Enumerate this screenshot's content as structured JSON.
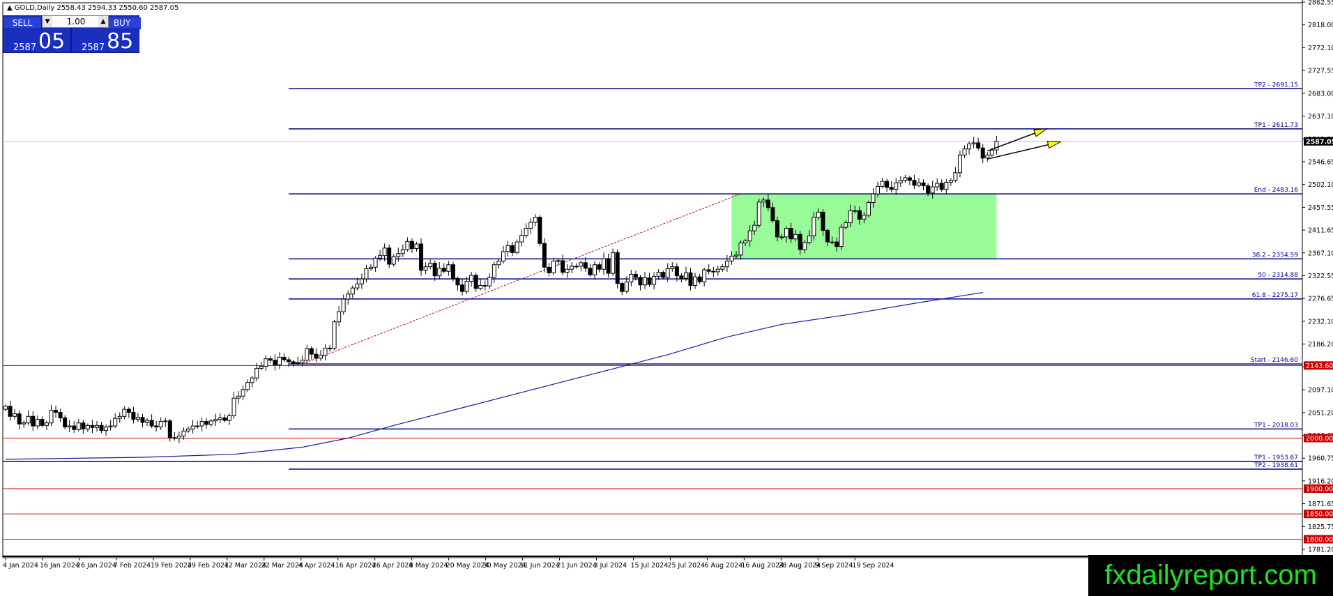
{
  "window": {
    "symbol_title": "GOLD,Daily",
    "ohlc": "2558.43 2594.33 2550.60 2587.05"
  },
  "trade_panel": {
    "sell_label": "SELL",
    "buy_label": "BUY",
    "lot_size": "1.00",
    "sell_price_prefix": "2587",
    "sell_price_big": "05",
    "buy_price_prefix": "2587",
    "buy_price_big": "85",
    "down_arrow": "▼",
    "up_arrow": "▲"
  },
  "brand": {
    "text": "fxdailyreport.com"
  },
  "colors": {
    "blue_level": "#00008b",
    "red_level": "#cc0000",
    "zone": "#98fb98",
    "candle_bull": "#ffffff",
    "candle_bear": "#000000",
    "arrow_fill": "#ffff00",
    "ma_line": "#1a1a9e",
    "trendline": "#cc0000"
  },
  "chart_data": {
    "type": "candlestick",
    "symbol": "GOLD",
    "timeframe": "Daily",
    "current_price": 2587.05,
    "current_price_label": "2587.05",
    "price_scale": {
      "ymin": 1780,
      "ymax": 2862.55,
      "tick_labels": [
        "2862.55",
        "2818.00",
        "2772.10",
        "2727.55",
        "2683.00",
        "2637.10",
        "2592.55",
        "2546.65",
        "2502.10",
        "2457.55",
        "2411.65",
        "2367.10",
        "2322.55",
        "2276.65",
        "2232.10",
        "2186.20",
        "2141.65",
        "2097.10",
        "2051.20",
        "2006.65",
        "1960.75",
        "1916.20",
        "1871.65",
        "1825.75",
        "1781.20"
      ]
    },
    "date_axis": {
      "labels": [
        "4 Jan 2024",
        "16 Jan 2024",
        "26 Jan 2024",
        "7 Feb 2024",
        "19 Feb 2024",
        "29 Feb 2024",
        "12 Mar 2024",
        "22 Mar 2024",
        "4 Apr 2024",
        "16 Apr 2024",
        "26 Apr 2024",
        "8 May 2024",
        "20 May 2024",
        "30 May 2024",
        "11 Jun 2024",
        "21 Jun 2024",
        "3 Jul 2024",
        "15 Jul 2024",
        "25 Jul 2024",
        "6 Aug 2024",
        "16 Aug 2024",
        "28 Aug 2024",
        "9 Sep 2024",
        "19 Sep 2024"
      ],
      "last_label_bar": 186
    },
    "blue_levels": [
      {
        "label": "TP2 - 2691.15",
        "price": 2691.15,
        "start_bar": 62
      },
      {
        "label": "TP1 - 2611.73",
        "price": 2611.73,
        "start_bar": 62
      },
      {
        "label": "End - 2483.16",
        "price": 2483.16,
        "start_bar": 62
      },
      {
        "label": "38.2 - 2354.59",
        "price": 2354.59,
        "start_bar": 62
      },
      {
        "label": "50 - 2314.88",
        "price": 2314.88,
        "start_bar": 62
      },
      {
        "label": "61.8 - 2275.17",
        "price": 2275.17,
        "start_bar": 62
      },
      {
        "label": "Start - 2146.60",
        "price": 2146.6,
        "start_bar": 62
      },
      {
        "label": "TP1 - 2018.03",
        "price": 2018.03,
        "start_bar": 62
      },
      {
        "label": "TP1 - 1953.67",
        "price": 1953.67,
        "start_bar": 0
      },
      {
        "label": "TP2 - 1938.61",
        "price": 1938.61,
        "start_bar": 62
      }
    ],
    "red_levels": [
      {
        "label": "2143.60",
        "price": 2143.6
      },
      {
        "label": "2000.00",
        "price": 2000.0
      },
      {
        "label": "1900.00",
        "price": 1900.0
      },
      {
        "label": "1850.00",
        "price": 1850.0
      },
      {
        "label": "1800.00",
        "price": 1800.0
      }
    ],
    "zone": {
      "start_bar": 159,
      "end_bar": 217,
      "low": 2354.59,
      "high": 2483.16
    },
    "trendline": {
      "from_bar": 65,
      "from_price": 2146.6,
      "to_bar": 161,
      "to_price": 2483.16
    },
    "moving_average": [
      [
        0,
        1958
      ],
      [
        30,
        1962
      ],
      [
        50,
        1968
      ],
      [
        65,
        1982
      ],
      [
        75,
        2000
      ],
      [
        85,
        2025
      ],
      [
        100,
        2060
      ],
      [
        115,
        2095
      ],
      [
        130,
        2130
      ],
      [
        145,
        2165
      ],
      [
        158,
        2200
      ],
      [
        170,
        2225
      ],
      [
        185,
        2245
      ],
      [
        200,
        2268
      ],
      [
        214,
        2288
      ]
    ],
    "arrows": [
      {
        "from_bar": 215,
        "from_price": 2568,
        "to_bar": 228,
        "to_price": 2612
      },
      {
        "from_bar": 215,
        "from_price": 2552,
        "to_bar": 231,
        "to_price": 2586
      }
    ],
    "series": [
      {
        "name": "close",
        "values": [
          2063,
          2043,
          2048,
          2028,
          2030,
          2043,
          2024,
          2037,
          2025,
          2030,
          2055,
          2051,
          2040,
          2022,
          2024,
          2017,
          2030,
          2018,
          2025,
          2021,
          2025,
          2015,
          2022,
          2024,
          2039,
          2043,
          2057,
          2051,
          2037,
          2041,
          2031,
          2035,
          2024,
          2022,
          2033,
          2034,
          2001,
          2000,
          2004,
          2014,
          2018,
          2024,
          2024,
          2033,
          2027,
          2034,
          2037,
          2040,
          2035,
          2044,
          2079,
          2083,
          2096,
          2110,
          2119,
          2138,
          2142,
          2157,
          2154,
          2145,
          2160,
          2155,
          2151,
          2148,
          2150,
          2154,
          2177,
          2166,
          2158,
          2164,
          2178,
          2178,
          2230,
          2250,
          2275,
          2285,
          2297,
          2305,
          2315,
          2335,
          2338,
          2356,
          2361,
          2376,
          2344,
          2359,
          2365,
          2373,
          2389,
          2375,
          2384,
          2332,
          2339,
          2346,
          2321,
          2336,
          2330,
          2343,
          2316,
          2303,
          2290,
          2310,
          2322,
          2296,
          2302,
          2301,
          2318,
          2343,
          2350,
          2369,
          2381,
          2367,
          2388,
          2401,
          2415,
          2427,
          2437,
          2385,
          2338,
          2327,
          2350,
          2351,
          2328,
          2334,
          2340,
          2340,
          2347,
          2336,
          2323,
          2343,
          2334,
          2355,
          2326,
          2367,
          2306,
          2290,
          2309,
          2324,
          2318,
          2303,
          2317,
          2304,
          2320,
          2328,
          2318,
          2335,
          2339,
          2321,
          2316,
          2327,
          2302,
          2319,
          2309,
          2333,
          2330,
          2329,
          2334,
          2339,
          2350,
          2360,
          2362,
          2386,
          2390,
          2410,
          2421,
          2467,
          2471,
          2456,
          2430,
          2398,
          2398,
          2415,
          2394,
          2403,
          2373,
          2387,
          2400,
          2437,
          2447,
          2411,
          2388,
          2388,
          2379,
          2417,
          2426,
          2450,
          2450,
          2433,
          2441,
          2466,
          2483,
          2498,
          2508,
          2496,
          2492,
          2505,
          2510,
          2515,
          2510,
          2500,
          2505,
          2499,
          2485,
          2497,
          2504,
          2492,
          2506,
          2510,
          2525,
          2560,
          2572,
          2582,
          2584,
          2574,
          2554,
          2560,
          2570,
          2587.05
        ]
      }
    ]
  }
}
